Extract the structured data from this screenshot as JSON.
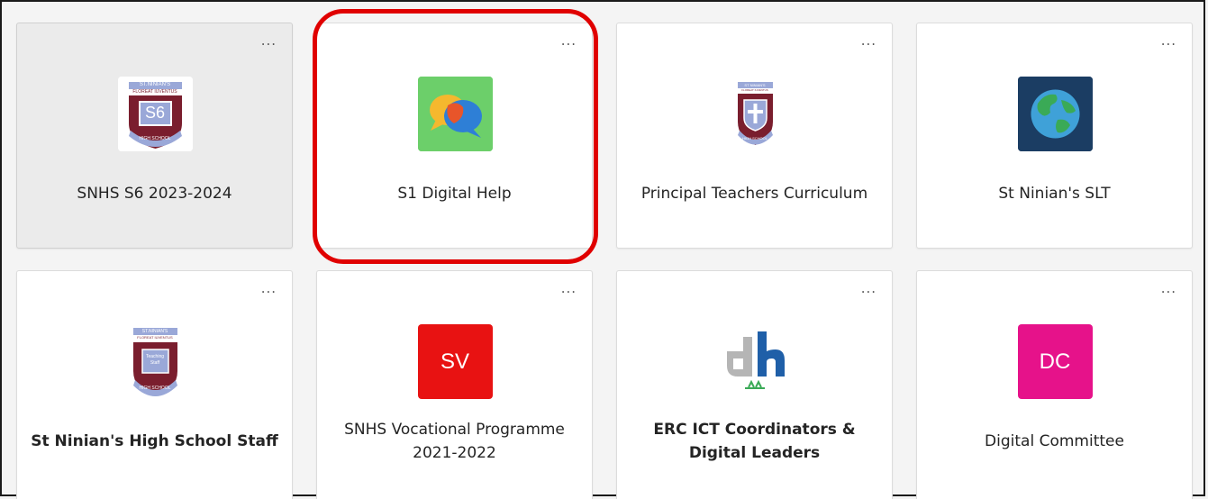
{
  "more_label": "...",
  "teams": [
    {
      "name": "SNHS S6 2023-2024",
      "logo": "crest-icon",
      "crest_top": "ST.NINIAN'S",
      "crest_motto": "FLOREAT IUVENTUS",
      "crest_mid": "S6",
      "crest_bottom": "HIGH SCHOOL",
      "selected": true,
      "bold": false
    },
    {
      "name": "S1 Digital Help",
      "logo": "chat-bubbles-icon",
      "bg": "#6ccf6a",
      "selected": false,
      "bold": false
    },
    {
      "name": "Principal Teachers Curriculum",
      "logo": "crest-icon",
      "crest_top": "ST NINIAN'S",
      "crest_motto": "FLOREAT IUVENTUS",
      "crest_mid": "",
      "crest_bottom": "HIGH SCHOOL",
      "selected": false,
      "bold": false
    },
    {
      "name": "St Ninian's SLT",
      "logo": "globe-icon",
      "bg": "#1b3d63",
      "selected": false,
      "bold": false
    },
    {
      "name": "St Ninian's High School Staff",
      "logo": "crest-icon",
      "crest_top": "ST.NINIAN'S",
      "crest_motto": "FLOREAT IUVENTUS",
      "crest_mid": "Teaching Staff",
      "crest_bottom": "HIGH SCHOOL",
      "selected": false,
      "bold": true
    },
    {
      "name": "SNHS Vocational Programme 2021-2022",
      "logo": "initials",
      "initials": "SV",
      "bg": "#e81212",
      "selected": false,
      "bold": false
    },
    {
      "name": "ERC ICT Coordinators & Digital Leaders",
      "logo": "dh-logo-icon",
      "logo_text": "dh",
      "selected": false,
      "bold": true
    },
    {
      "name": "Digital Committee",
      "logo": "initials",
      "initials": "DC",
      "bg": "#e6128a",
      "selected": false,
      "bold": false
    }
  ],
  "colors": {
    "highlight": "#e00000",
    "crest_maroon": "#7a1e2e",
    "crest_blue": "#9aa8d8",
    "dh_grey": "#b5b5b5",
    "dh_blue": "#1f5fa8"
  }
}
